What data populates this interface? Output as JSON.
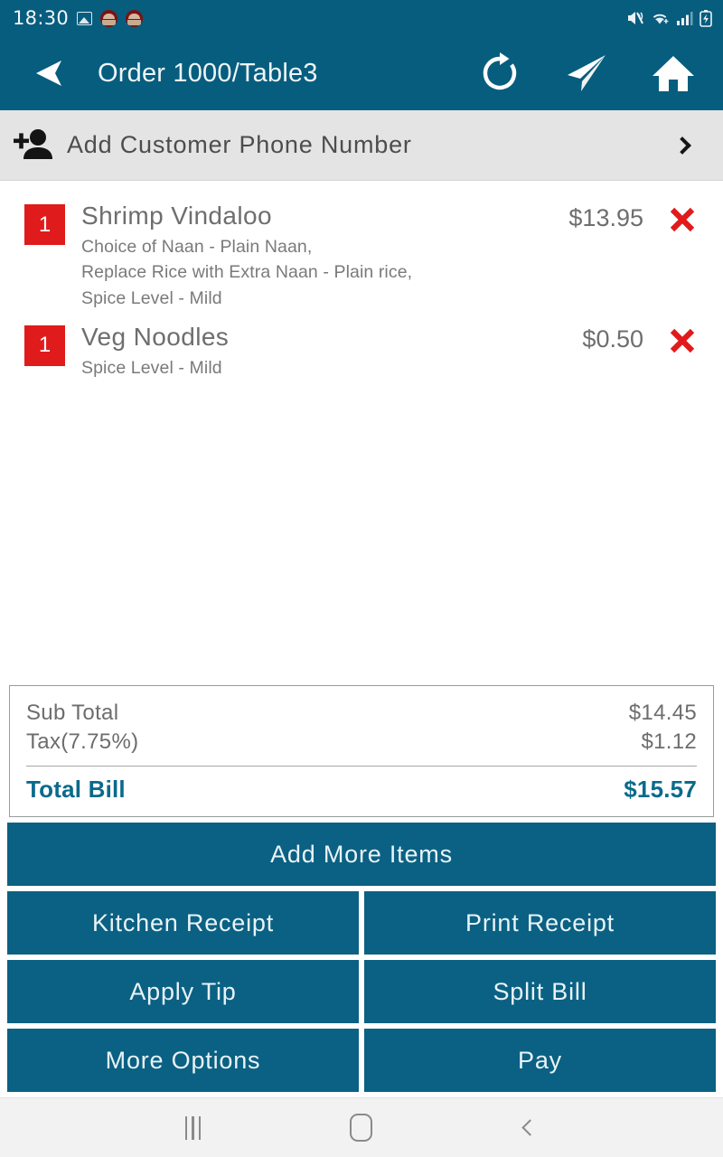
{
  "status_bar": {
    "time": "18:30",
    "left_icons": [
      "gallery-icon",
      "app-notification-icon",
      "app-notification-icon"
    ],
    "right_icons": [
      "mute-vibrate-icon",
      "wifi-icon",
      "cellular-signal-icon",
      "battery-charging-icon"
    ]
  },
  "app_bar": {
    "back_label": "back-arrow-icon",
    "title": "Order 1000/Table3",
    "actions": [
      {
        "name": "refresh-icon"
      },
      {
        "name": "send-icon"
      },
      {
        "name": "home-icon"
      }
    ]
  },
  "customer": {
    "icon": "person-add-icon",
    "label": "Add Customer Phone Number",
    "chevron": "chevron-right-icon"
  },
  "order": {
    "items": [
      {
        "qty": "1",
        "name": "Shrimp Vindaloo",
        "modifiers": "Choice of Naan - Plain Naan,\nReplace Rice with Extra Naan - Plain rice,\nSpice Level - Mild",
        "price": "$13.95",
        "remove": "remove-item-icon"
      },
      {
        "qty": "1",
        "name": "Veg Noodles",
        "modifiers": "Spice Level - Mild",
        "price": "$0.50",
        "remove": "remove-item-icon"
      }
    ]
  },
  "totals": {
    "sub_total_label": "Sub Total",
    "sub_total_value": "$14.45",
    "tax_label": "Tax(7.75%)",
    "tax_value": "$1.12",
    "total_label": "Total Bill",
    "total_value": "$15.57"
  },
  "buttons": {
    "add_more_items": "Add More Items",
    "kitchen_receipt": "Kitchen Receipt",
    "print_receipt": "Print Receipt",
    "apply_tip": "Apply Tip",
    "split_bill": "Split Bill",
    "more_options": "More Options",
    "pay": "Pay"
  },
  "nav_bar": {
    "recents": "recents-icon",
    "home": "home-square-icon",
    "back": "back-chevron-icon"
  },
  "colors": {
    "brand_teal": "#075D7E",
    "button_teal": "#0A6183",
    "total_teal": "#0B6A8C",
    "qty_red": "#E01B1B",
    "remove_red": "#E21A1A",
    "customer_bar": "#e4e4e4"
  }
}
